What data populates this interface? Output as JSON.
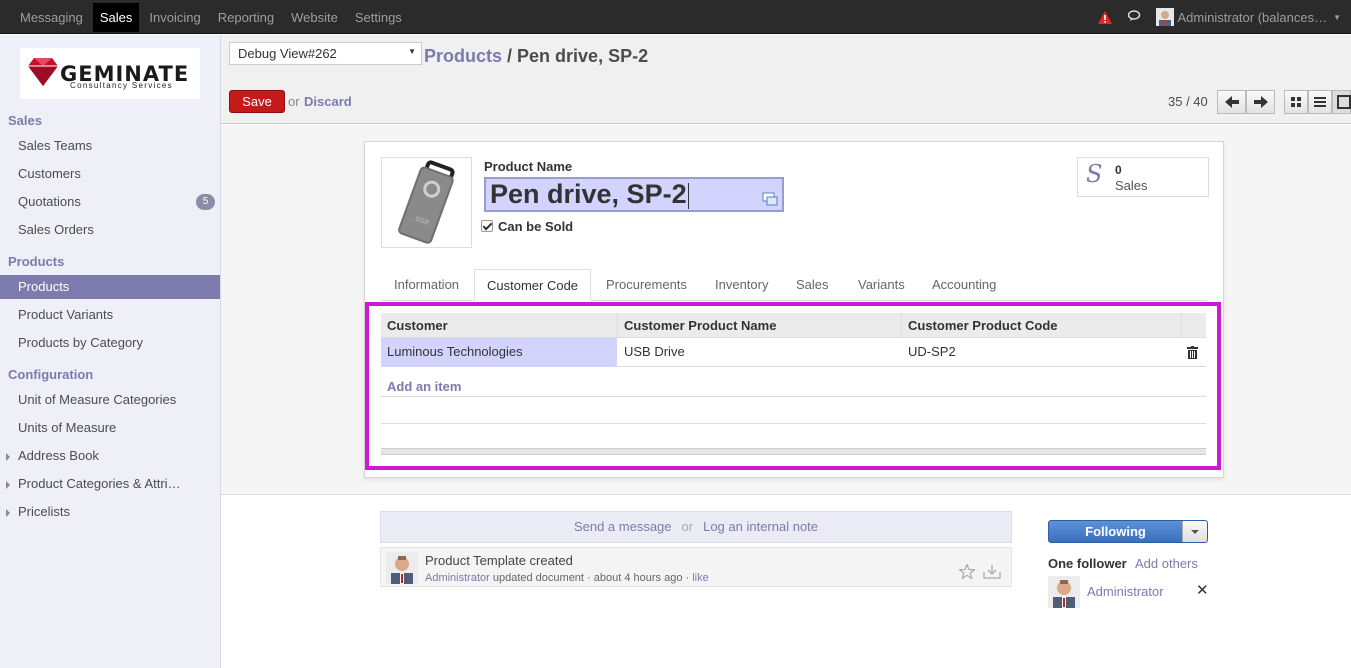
{
  "topbar": {
    "menu": [
      "Messaging",
      "Sales",
      "Invoicing",
      "Reporting",
      "Website",
      "Settings"
    ],
    "active": "Sales",
    "user": "Administrator (balances…"
  },
  "logo": {
    "brand": "GEMINATE",
    "sub": "Consultancy Services"
  },
  "sidebar": {
    "sections": [
      {
        "title": "Sales",
        "items": [
          "Sales Teams",
          "Customers",
          "Quotations",
          "Sales Orders"
        ]
      },
      {
        "title": "Products",
        "items": [
          "Products",
          "Product Variants",
          "Products by Category"
        ]
      },
      {
        "title": "Configuration",
        "items": [
          "Unit of Measure Categories",
          "Units of Measure",
          "Address Book",
          "Product Categories & Attri…",
          "Pricelists"
        ]
      }
    ],
    "quotations_badge": "5"
  },
  "control": {
    "debug_select": "Debug View#262",
    "breadcrumb_parent": "Products",
    "breadcrumb_sep": " / ",
    "breadcrumb_current": "Pen drive, SP-2",
    "save_label": "Save",
    "or_label": "or",
    "discard_label": "Discard",
    "pager": "35 / 40"
  },
  "form": {
    "product_name_label": "Product Name",
    "product_name_value": "Pen drive, SP-2",
    "can_be_sold_label": "Can be Sold",
    "stat_count": "0",
    "stat_label": "Sales",
    "tabs": [
      "Information",
      "Customer Code",
      "Procurements",
      "Inventory",
      "Sales",
      "Variants",
      "Accounting"
    ],
    "active_tab": "Customer Code"
  },
  "grid": {
    "headers": [
      "Customer",
      "Customer Product Name",
      "Customer Product Code"
    ],
    "rows": [
      {
        "customer": "Luminous Technologies",
        "product_name": "USB Drive",
        "product_code": "UD-SP2"
      }
    ],
    "add_item": "Add an item"
  },
  "chatter": {
    "send_message": "Send a message",
    "or": "or",
    "log_note": "Log an internal note",
    "message_title": "Product Template created",
    "message_author": "Administrator",
    "message_action": " updated document · about 4 hours ago · ",
    "message_like": "like",
    "following_label": "Following",
    "one_follower": "One follower",
    "add_others": "Add others",
    "follower_name": "Administrator",
    "remove_icon_text": "✕"
  },
  "colors": {
    "accent": "#7c7bad",
    "save": "#c51a1a",
    "highlight": "#cc19d6",
    "selected": "#d3d3ff"
  }
}
